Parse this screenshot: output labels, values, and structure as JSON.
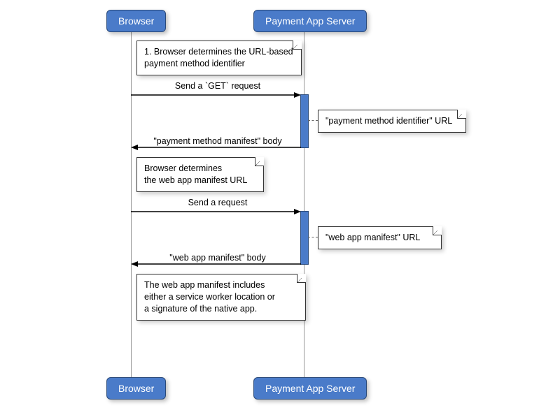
{
  "participants": {
    "left": "Browser",
    "right": "Payment App Server"
  },
  "notes": {
    "n1": "1. Browser determines the URL-based\npayment method identifier",
    "n2": "\"payment method identifier\" URL",
    "n3": "Browser determines\nthe web app manifest URL",
    "n4": "\"web app manifest\" URL",
    "n5": "The web app manifest includes\neither a service worker location or\na signature of the native app."
  },
  "messages": {
    "m1": "Send a `GET` request",
    "r1": "\"payment method manifest\" body",
    "m2": "Send a request",
    "r2": "\"web app manifest\" body"
  },
  "chart_data": {
    "type": "sequence-diagram",
    "participants": [
      "Browser",
      "Payment App Server"
    ],
    "steps": [
      {
        "type": "note",
        "at": "Browser",
        "text": "1. Browser determines the URL-based payment method identifier"
      },
      {
        "type": "message",
        "from": "Browser",
        "to": "Payment App Server",
        "label": "Send a `GET` request"
      },
      {
        "type": "note",
        "at": "Payment App Server",
        "text": "\"payment method identifier\" URL"
      },
      {
        "type": "return",
        "from": "Payment App Server",
        "to": "Browser",
        "label": "\"payment method manifest\" body"
      },
      {
        "type": "note",
        "at": "Browser",
        "text": "Browser determines the web app manifest URL"
      },
      {
        "type": "message",
        "from": "Browser",
        "to": "Payment App Server",
        "label": "Send a request"
      },
      {
        "type": "note",
        "at": "Payment App Server",
        "text": "\"web app manifest\" URL"
      },
      {
        "type": "return",
        "from": "Payment App Server",
        "to": "Browser",
        "label": "\"web app manifest\" body"
      },
      {
        "type": "note",
        "at": "Browser",
        "text": "The web app manifest includes either a service worker location or a signature of the native app."
      }
    ]
  }
}
